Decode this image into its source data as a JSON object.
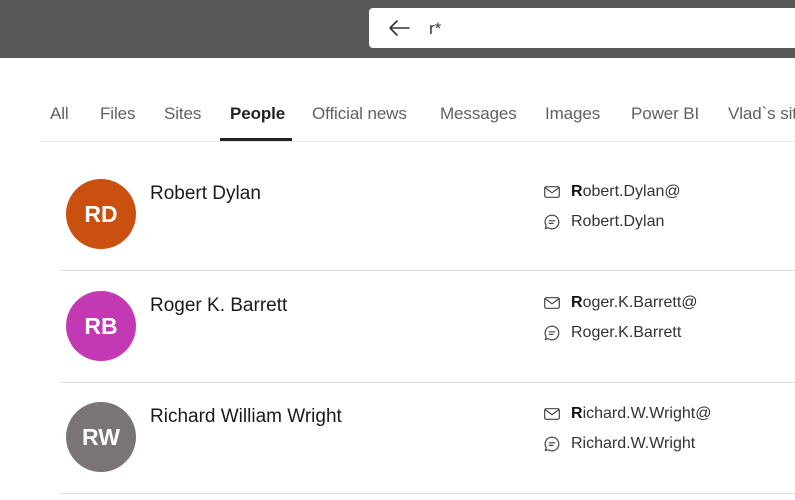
{
  "search": {
    "query": "r*"
  },
  "tabs": [
    {
      "label": "All",
      "active": false
    },
    {
      "label": "Files",
      "active": false
    },
    {
      "label": "Sites",
      "active": false
    },
    {
      "label": "People",
      "active": true
    },
    {
      "label": "Official news",
      "active": false
    },
    {
      "label": "Messages",
      "active": false
    },
    {
      "label": "Images",
      "active": false
    },
    {
      "label": "Power BI",
      "active": false
    },
    {
      "label": "Vlad`s site",
      "active": false
    }
  ],
  "people": [
    {
      "initials": "RD",
      "name": "Robert Dylan",
      "avatar_color": "#ca5010",
      "email_highlight": "R",
      "email_rest": "obert.Dylan@",
      "chat": "Robert.Dylan"
    },
    {
      "initials": "RB",
      "name": "Roger K. Barrett",
      "avatar_color": "#c239b3",
      "email_highlight": "R",
      "email_rest": "oger.K.Barrett@",
      "chat": "Roger.K.Barrett"
    },
    {
      "initials": "RW",
      "name": "Richard William Wright",
      "avatar_color": "#7a7574",
      "email_highlight": "R",
      "email_rest": "ichard.W.Wright@",
      "chat": "Richard.W.Wright"
    }
  ],
  "icons": {
    "back": "arrow-left-icon",
    "email": "mail-icon",
    "chat": "chat-icon"
  }
}
